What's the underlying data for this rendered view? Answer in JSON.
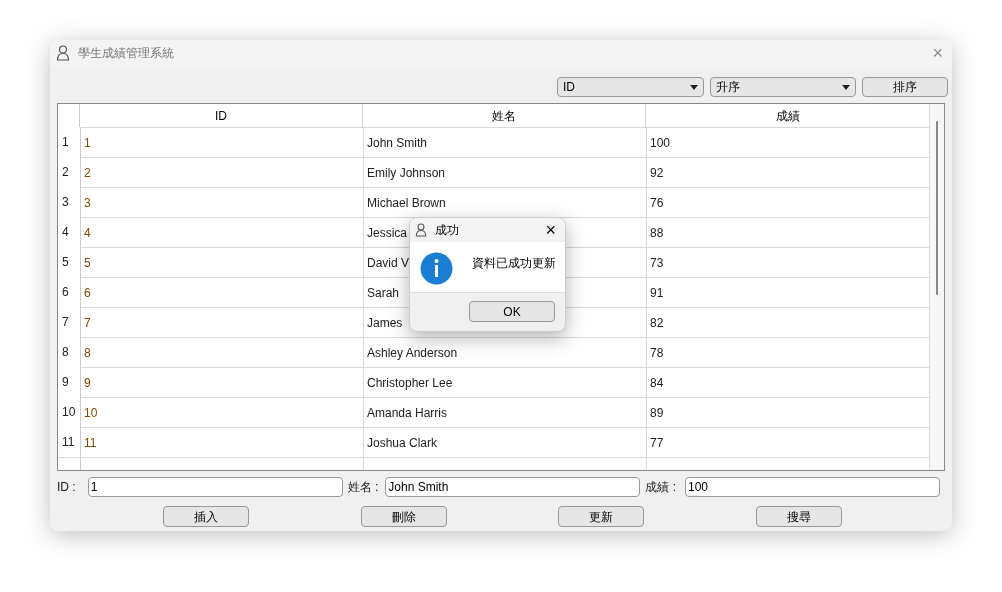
{
  "window": {
    "title": "學生成績管理系統",
    "close": "×"
  },
  "sort": {
    "field": "ID",
    "order": "升序",
    "button": "排序"
  },
  "table": {
    "columns": [
      "ID",
      "姓名",
      "成績"
    ],
    "rows": [
      {
        "number": "1",
        "cells": [
          "1",
          "John Smith",
          "100"
        ]
      },
      {
        "number": "2",
        "cells": [
          "2",
          "Emily Johnson",
          "92"
        ]
      },
      {
        "number": "3",
        "cells": [
          "3",
          "Michael Brown",
          "76"
        ]
      },
      {
        "number": "4",
        "cells": [
          "4",
          "Jessica",
          "88"
        ]
      },
      {
        "number": "5",
        "cells": [
          "5",
          "David V",
          "73"
        ]
      },
      {
        "number": "6",
        "cells": [
          "6",
          "Sarah",
          "91"
        ]
      },
      {
        "number": "7",
        "cells": [
          "7",
          "James",
          "82"
        ]
      },
      {
        "number": "8",
        "cells": [
          "8",
          "Ashley Anderson",
          "78"
        ]
      },
      {
        "number": "9",
        "cells": [
          "9",
          "Christopher Lee",
          "84"
        ]
      },
      {
        "number": "10",
        "cells": [
          "10",
          "Amanda Harris",
          "89"
        ]
      },
      {
        "number": "11",
        "cells": [
          "11",
          "Joshua Clark",
          "77"
        ]
      }
    ]
  },
  "form": [
    {
      "label": "ID :",
      "value": "1"
    },
    {
      "label": "姓名 :",
      "value": "John Smith"
    },
    {
      "label": "成績 :",
      "value": "100"
    }
  ],
  "buttons": [
    "插入",
    "刪除",
    "更新",
    "搜尋"
  ],
  "dialog": {
    "title": "成功",
    "close": "×",
    "message": "資料已成功更新",
    "button": "OK"
  }
}
